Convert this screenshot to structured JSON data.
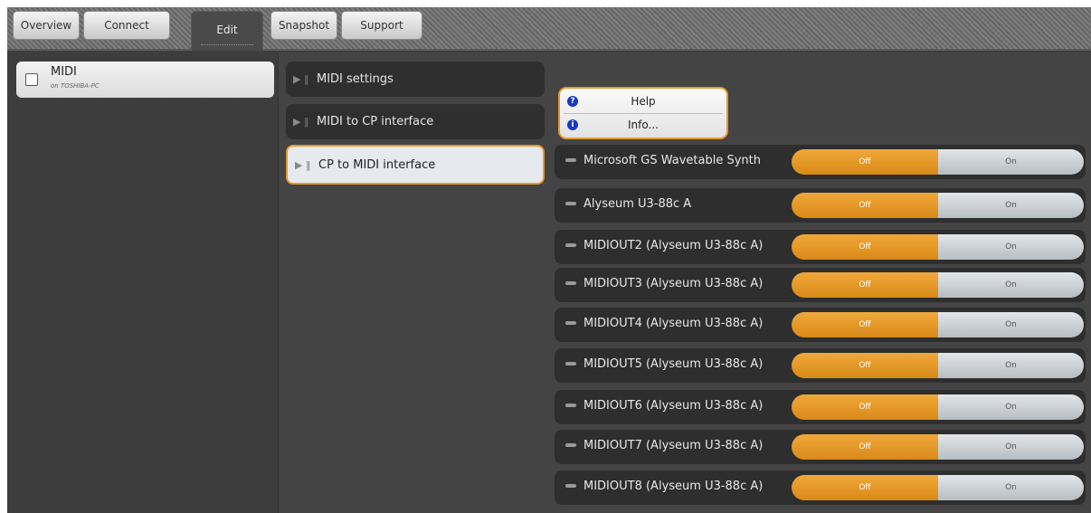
{
  "tabs": [
    {
      "label": "Overview"
    },
    {
      "label": "Connect"
    },
    {
      "label": "Edit"
    },
    {
      "label": "Snapshot"
    },
    {
      "label": "Support"
    }
  ],
  "active_tab": "Edit",
  "device": {
    "name": "MIDI",
    "host": "on TOSHIBA-PC"
  },
  "nav": [
    {
      "label": "MIDI settings"
    },
    {
      "label": "MIDI to CP interface"
    },
    {
      "label": "CP to MIDI interface"
    }
  ],
  "context_menu": {
    "help": "Help",
    "info": "Info..."
  },
  "ports": [
    {
      "name": "Microsoft GS Wavetable Synth",
      "off": "Off",
      "on": "On"
    },
    {
      "name": "Alyseum U3-88c A",
      "off": "Off",
      "on": "On"
    },
    {
      "name": "MIDIOUT2 (Alyseum U3-88c A)",
      "off": "Off",
      "on": "On"
    },
    {
      "name": "MIDIOUT3 (Alyseum U3-88c A)",
      "off": "Off",
      "on": "On"
    },
    {
      "name": "MIDIOUT4 (Alyseum U3-88c A)",
      "off": "Off",
      "on": "On"
    },
    {
      "name": "MIDIOUT5 (Alyseum U3-88c A)",
      "off": "Off",
      "on": "On"
    },
    {
      "name": "MIDIOUT6 (Alyseum U3-88c A)",
      "off": "Off",
      "on": "On"
    },
    {
      "name": "MIDIOUT7 (Alyseum U3-88c A)",
      "off": "Off",
      "on": "On"
    },
    {
      "name": "MIDIOUT8 (Alyseum U3-88c A)",
      "off": "Off",
      "on": "On"
    }
  ],
  "colors": {
    "accent": "#e39a2d",
    "panel": "#3f3f3f",
    "row": "#2e2e2e",
    "menu_icon": "#1638c5"
  }
}
